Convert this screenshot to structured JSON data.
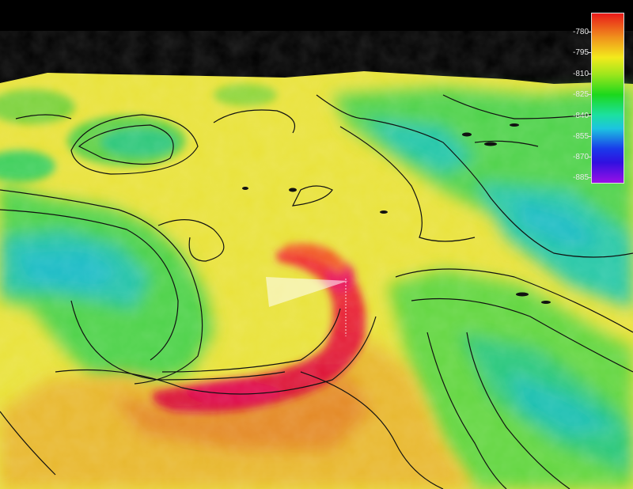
{
  "legend": {
    "ticks": [
      "-780",
      "-795",
      "-810",
      "-825",
      "-840",
      "-855",
      "-870",
      "-885"
    ]
  },
  "colors": {
    "shallow": "#e8101e",
    "mid_high": "#f5e62a",
    "mid": "#32d232",
    "deep": "#1ec3b4",
    "deepest": "#8c14dc",
    "background": "#000000",
    "contour": "#111111"
  }
}
